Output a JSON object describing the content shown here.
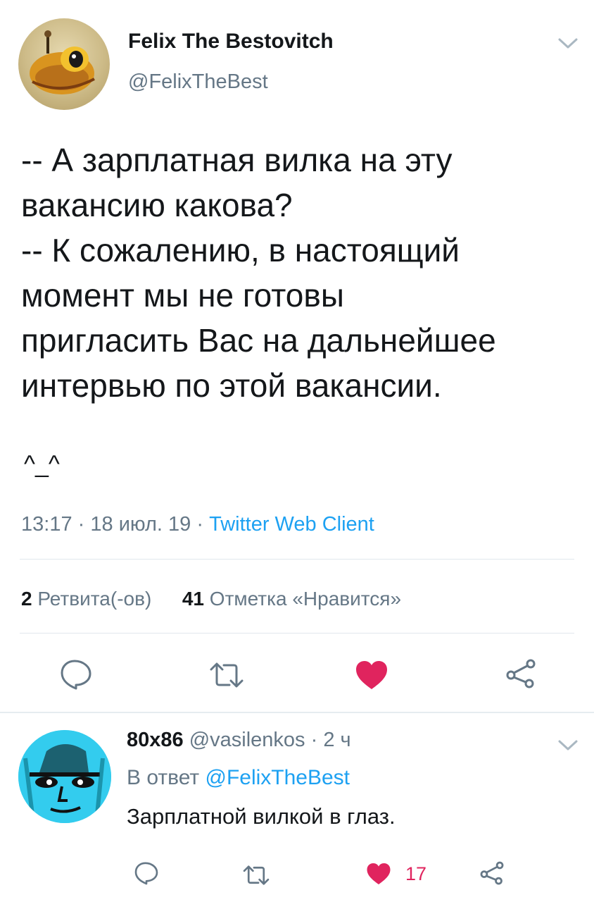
{
  "tweet": {
    "author_name": "Felix The Bestovitch",
    "author_handle": "@FelixTheBest",
    "text_lines": [
      "-- А зарплатная вилка на эту",
      "вакансию какова?",
      "-- К сожалению, в настоящий",
      "момент мы не готовы",
      "пригласить Вас на дальнейшее",
      "интервью по этой вакансии."
    ],
    "emoticon": "^_^",
    "time": "13:17",
    "date": "18 июл. 19",
    "source": "Twitter Web Client",
    "retweets_count": "2",
    "retweets_label": "Ретвита(-ов)",
    "likes_count": "41",
    "likes_label": "Отметка «Нравится»",
    "sep": "·"
  },
  "reply": {
    "author_name": "80x86",
    "author_handle": "@vasilenkos",
    "time_ago": "2 ч",
    "in_reply_prefix": "В ответ",
    "in_reply_handle": "@FelixTheBest",
    "text": "Зарплатной вилкой в глаз.",
    "likes_count": "17"
  },
  "colors": {
    "accent": "#1da1f2",
    "like": "#e0245e",
    "muted": "#657786",
    "icon": "#657786"
  },
  "icons": {
    "reply": "speech-bubble-icon",
    "retweet": "retweet-arrows-icon",
    "like": "heart-icon",
    "share": "share-nodes-icon",
    "menu": "chevron-down-icon"
  }
}
